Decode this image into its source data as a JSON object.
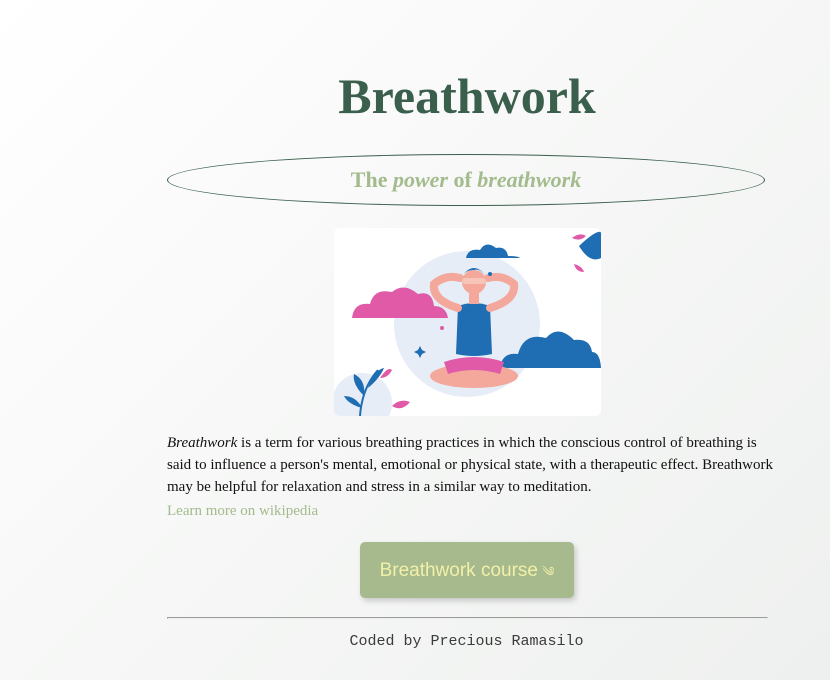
{
  "header": {
    "title": "Breathwork"
  },
  "subtitle": {
    "word_the": "The",
    "word_power": "power",
    "word_of": "of",
    "word_breathwork": "breathwork"
  },
  "hero_image": {
    "icon": "meditation-illustration-icon"
  },
  "description": {
    "italic_term": "Breathwork",
    "body": " is a term for various breathing practices in which the conscious control of breathing is said to influence a person's mental, emotional or physical state, with a therapeutic effect. Breathwork may be helpful for relaxation and stress in a similar way to meditation."
  },
  "links": {
    "wiki": "Learn more on wikipedia"
  },
  "cta": {
    "label": "Breathwork course",
    "icon": "wind-icon",
    "glyph": "༄"
  },
  "footer": {
    "credit": "Coded by Precious Ramasilo"
  },
  "colors": {
    "title": "#3a5f4c",
    "accent_green": "#a3bb8d",
    "button_bg": "#a6ba8e",
    "button_text": "#f2f0a8",
    "illustration_blue": "#1f6db3",
    "illustration_pink": "#e05aa8",
    "skin": "#f4a89b"
  }
}
